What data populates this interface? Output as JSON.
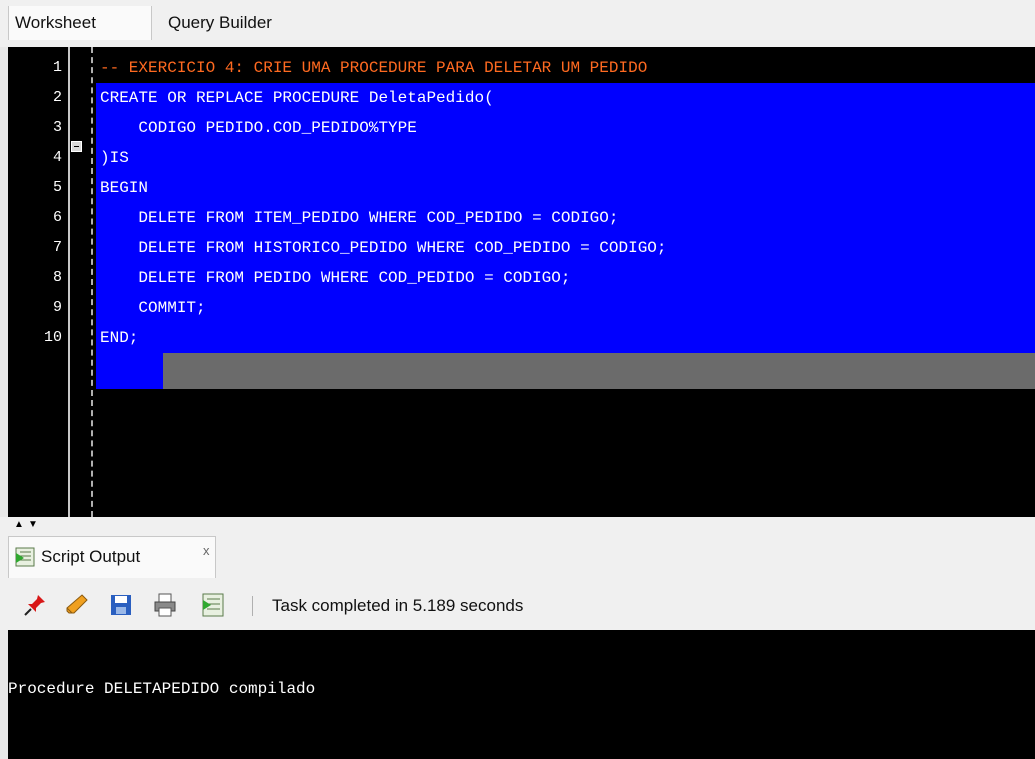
{
  "tabs": {
    "worksheet": "Worksheet",
    "query_builder": "Query Builder"
  },
  "editor": {
    "line_numbers": [
      "1",
      "2",
      "3",
      "4",
      "5",
      "6",
      "7",
      "8",
      "9",
      "10"
    ],
    "lines": [
      "-- EXERCICIO 4: CRIE UMA PROCEDURE PARA DELETAR UM PEDIDO",
      "CREATE OR REPLACE PROCEDURE DeletaPedido(",
      "    CODIGO PEDIDO.COD_PEDIDO%TYPE",
      ")IS",
      "BEGIN",
      "    DELETE FROM ITEM_PEDIDO WHERE COD_PEDIDO = CODIGO;",
      "    DELETE FROM HISTORICO_PEDIDO WHERE COD_PEDIDO = CODIGO;",
      "    DELETE FROM PEDIDO WHERE COD_PEDIDO = CODIGO;",
      "    COMMIT;",
      "END;"
    ],
    "colors": {
      "comment": "#ff6a20",
      "selection": "#0000ff",
      "current_line": "#6b6b6b",
      "background": "#000000"
    }
  },
  "output": {
    "tab_label": "Script Output",
    "close_glyph": "x",
    "toolbar_icons": [
      "pin-icon",
      "eraser-icon",
      "save-icon",
      "print-icon",
      "script-output-icon"
    ],
    "status": "Task completed in 5.189 seconds",
    "text": "Procedure DELETAPEDIDO compilado"
  }
}
